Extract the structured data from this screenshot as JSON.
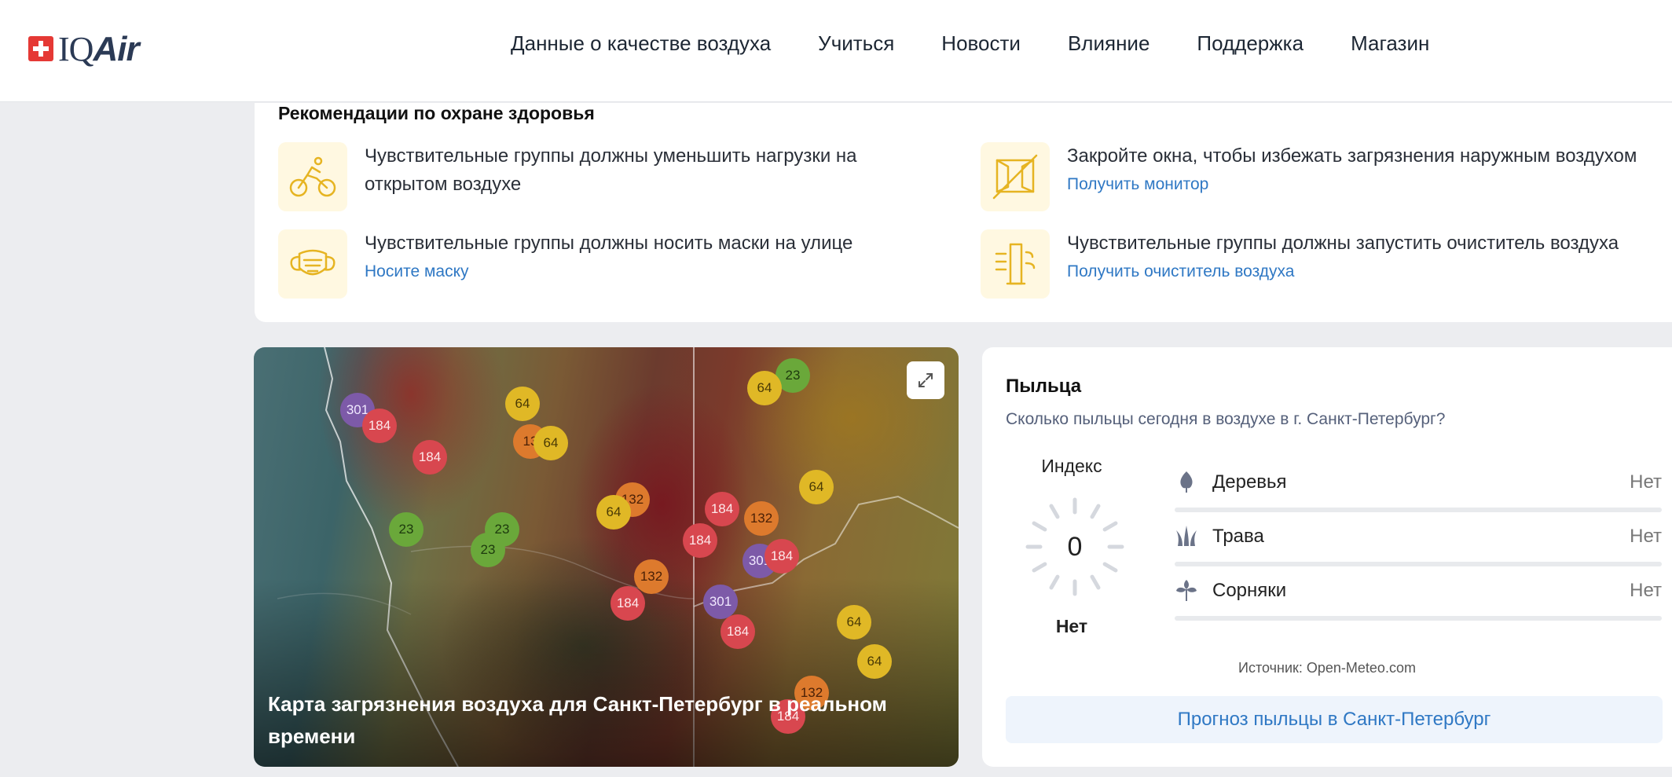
{
  "brand": {
    "flag_icon": "swiss-cross-icon",
    "name_iq": "IQ",
    "name_air": "Air",
    "accent": "#e53935"
  },
  "nav": [
    {
      "label": "Данные о качестве воздуха"
    },
    {
      "label": "Учиться"
    },
    {
      "label": "Новости"
    },
    {
      "label": "Влияние"
    },
    {
      "label": "Поддержка"
    },
    {
      "label": "Магазин"
    }
  ],
  "health": {
    "title": "Рекомендации по охране здоровья",
    "items": [
      {
        "icon": "cycling-icon",
        "text": "Чувствительные группы должны уменьшить нагрузки на открытом воздухе",
        "link": ""
      },
      {
        "icon": "window-closed-icon",
        "text": "Закройте окна, чтобы избежать загрязнения наружным воздухом",
        "link": "Получить монитор"
      },
      {
        "icon": "mask-icon",
        "text": "Чувствительные группы должны носить маски на улице",
        "link": "Носите маску"
      },
      {
        "icon": "air-purifier-icon",
        "text": "Чувствительные группы должны запустить очиститель воздуха",
        "link": "Получить очиститель воздуха"
      }
    ],
    "icon_color": "#e6b422"
  },
  "map": {
    "caption": "Карта загрязнения воздуха для Санкт-Петербург в реальном времени",
    "expand_icon": "expand-icon",
    "stations": [
      "301",
      "184",
      "184",
      "64",
      "13",
      "64",
      "23",
      "23",
      "23",
      "132",
      "64",
      "184",
      "184",
      "132",
      "64",
      "301",
      "184",
      "132",
      "184",
      "301",
      "184",
      "64",
      "64",
      "132",
      "184",
      "23",
      "64"
    ]
  },
  "pollen": {
    "title": "Пыльца",
    "subtitle": "Сколько пыльцы сегодня в воздухе в г. Санкт-Петербург?",
    "index_label": "Индекс",
    "index_value": "0",
    "index_status": "Нет",
    "types": [
      {
        "icon": "tree-icon",
        "name": "Деревья",
        "value": "Нет",
        "level": 0
      },
      {
        "icon": "grass-icon",
        "name": "Трава",
        "value": "Нет",
        "level": 0
      },
      {
        "icon": "weed-icon",
        "name": "Сорняки",
        "value": "Нет",
        "level": 0
      }
    ],
    "source": "Источник: Open-Meteo.com",
    "forecast_button": "Прогноз пыльцы в Санкт-Петербург"
  }
}
